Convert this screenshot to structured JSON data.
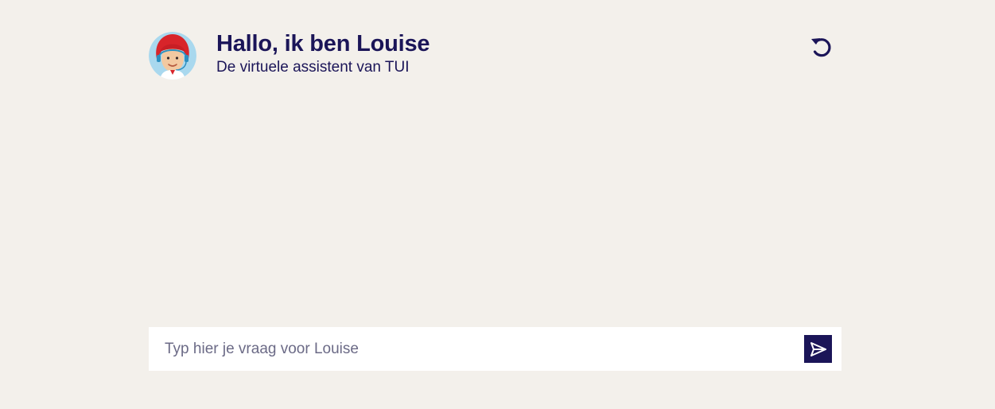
{
  "header": {
    "title": "Hallo, ik ben Louise",
    "subtitle": "De virtuele assistent van TUI",
    "avatar_icon": "assistant-avatar-icon",
    "restart_icon": "restart-icon"
  },
  "composer": {
    "value": "",
    "placeholder": "Typ hier je vraag voor Louise",
    "send_icon": "send-icon"
  },
  "colors": {
    "background": "#f3f0eb",
    "brand_navy": "#1b1558",
    "input_background": "#ffffff",
    "placeholder": "#6b6a86"
  }
}
